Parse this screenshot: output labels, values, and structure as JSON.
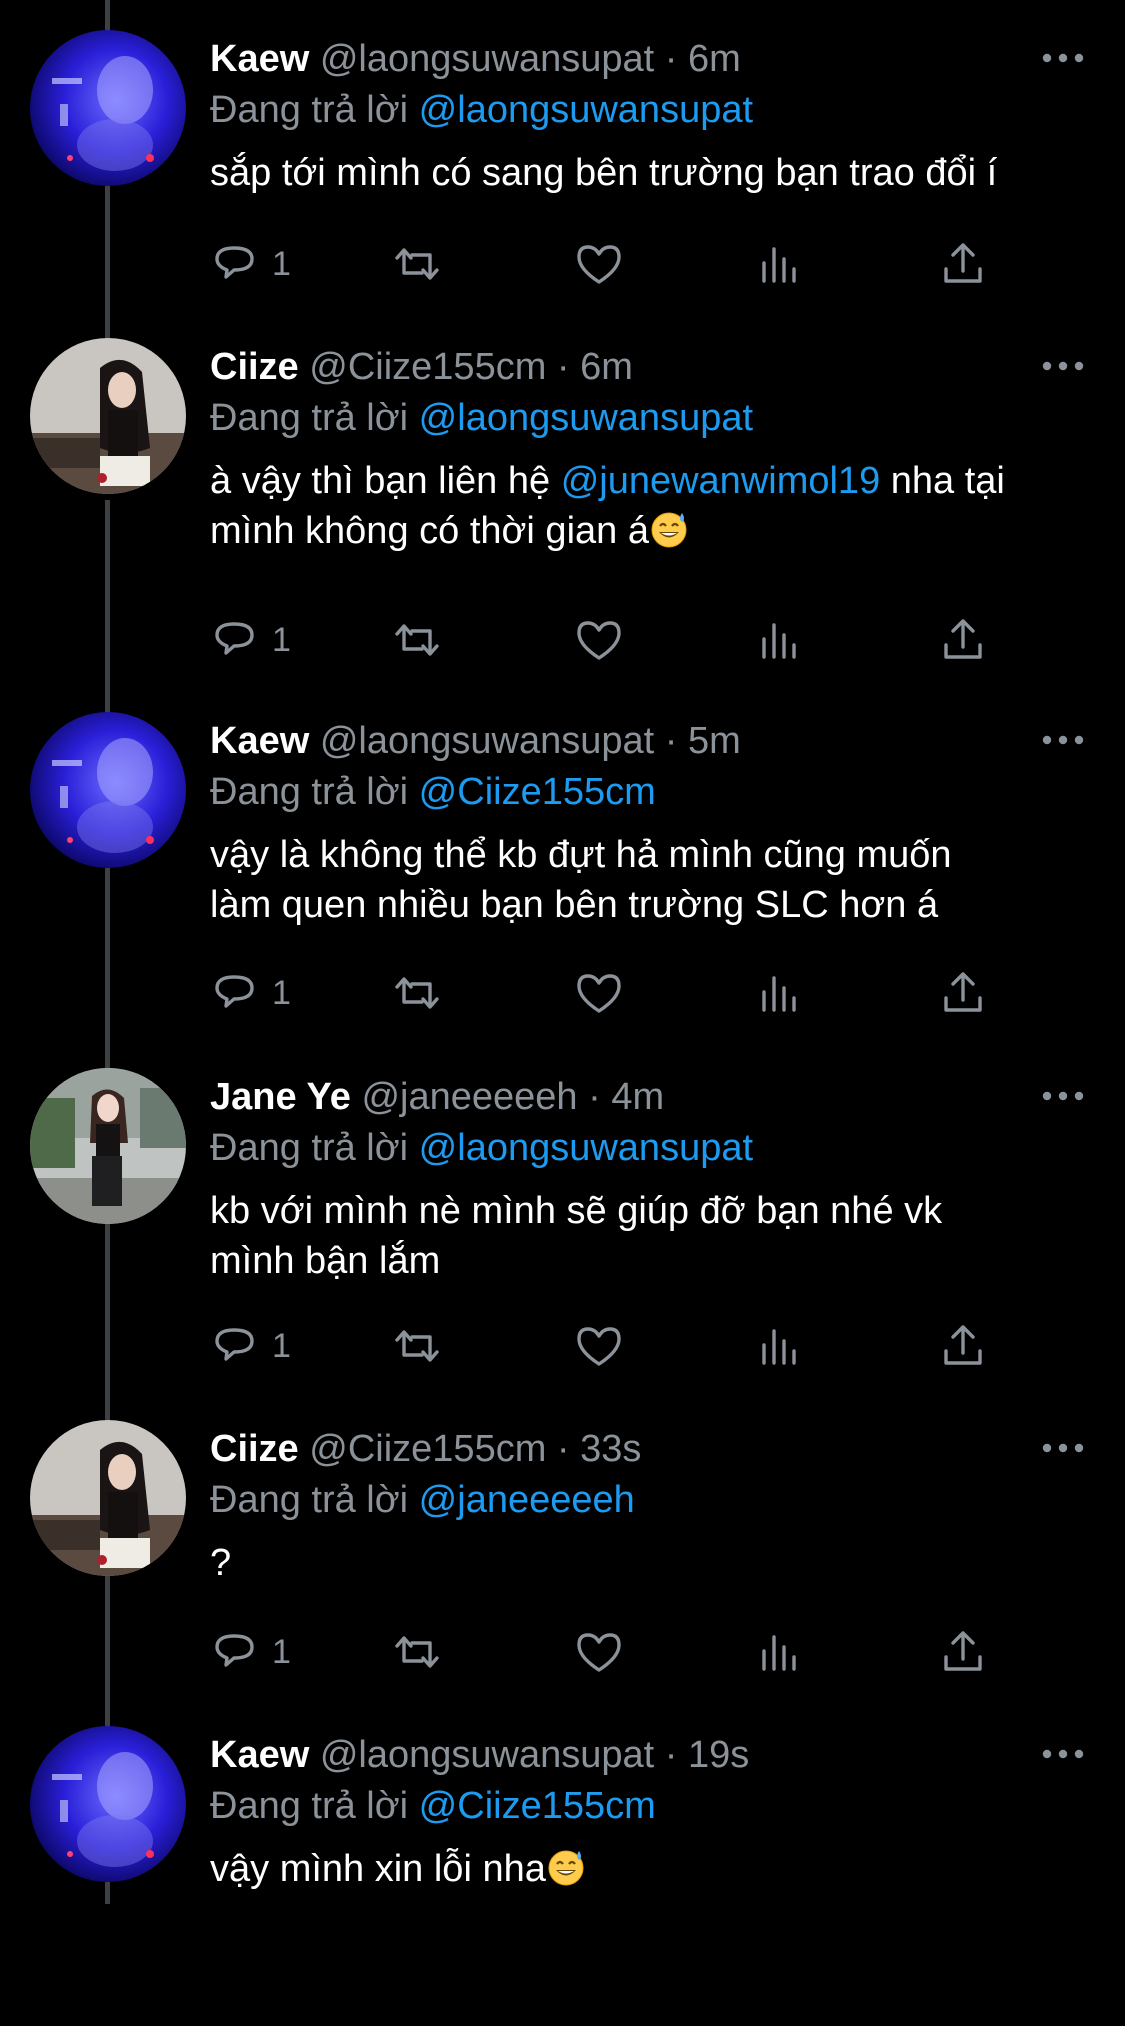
{
  "reply_prefix": "Đang trả lời",
  "colors": {
    "background": "#000000",
    "link": "#1d9bf0",
    "secondary_text": "#8b9299",
    "icon": "#8b9299"
  },
  "tweets": [
    {
      "name": "Kaew",
      "handle": "@laongsuwansupat",
      "sep": "·",
      "time": "6m",
      "reply_to": "@laongsuwansupat",
      "avatar": "blue-neon-photo",
      "text_parts": [
        {
          "line": 0,
          "t": "sắp tới mình có sang bên trường bạn trao đổi í"
        }
      ],
      "reply_count": "1"
    },
    {
      "name": "Ciize",
      "handle": "@Ciize155cm",
      "sep": "·",
      "time": "6m",
      "reply_to": "@laongsuwansupat",
      "avatar": "portrait-photo",
      "text_parts": [
        {
          "line": 0,
          "t": "à vậy thì bạn liên hệ "
        },
        {
          "line": 0,
          "t": "@junewanwimol19",
          "link": true
        },
        {
          "line": 0,
          "t": " nha tại"
        },
        {
          "line": 1,
          "t": "mình không có thời gian á"
        },
        {
          "line": 1,
          "emoji": "grinning-sweat-emoji"
        }
      ],
      "reply_count": "1"
    },
    {
      "name": "Kaew",
      "handle": "@laongsuwansupat",
      "sep": "·",
      "time": "5m",
      "reply_to": "@Ciize155cm",
      "avatar": "blue-neon-photo",
      "text_parts": [
        {
          "line": 0,
          "t": "vậy là không thể kb đựt hả mình cũng muốn"
        },
        {
          "line": 1,
          "t": "làm quen nhiều bạn bên trường SLC hơn á"
        }
      ],
      "reply_count": "1"
    },
    {
      "name": "Jane Ye",
      "handle": "@janeeeeeh",
      "sep": "·",
      "time": "4m",
      "reply_to": "@laongsuwansupat",
      "avatar": "outdoor-photo",
      "text_parts": [
        {
          "line": 0,
          "t": "kb với mình nè mình sẽ giúp đỡ bạn nhé vk"
        },
        {
          "line": 1,
          "t": "mình bận lắm"
        }
      ],
      "reply_count": "1"
    },
    {
      "name": "Ciize",
      "handle": "@Ciize155cm",
      "sep": "·",
      "time": "33s",
      "reply_to": "@janeeeeeh",
      "avatar": "portrait-photo",
      "text_parts": [
        {
          "line": 0,
          "t": "?"
        }
      ],
      "reply_count": "1"
    },
    {
      "name": "Kaew",
      "handle": "@laongsuwansupat",
      "sep": "·",
      "time": "19s",
      "reply_to": "@Ciize155cm",
      "avatar": "blue-neon-photo",
      "text_parts": [
        {
          "line": 0,
          "t": "vậy mình xin lỗi nha"
        },
        {
          "line": 0,
          "emoji": "grinning-sweat-emoji"
        }
      ],
      "reply_count": null
    }
  ]
}
